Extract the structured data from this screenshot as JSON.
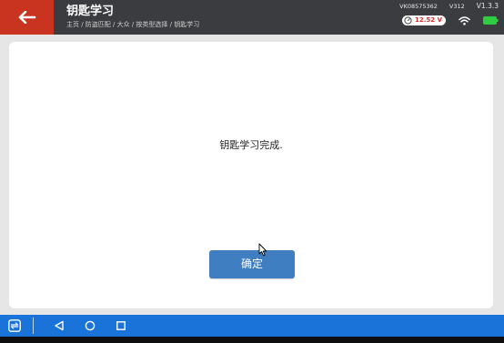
{
  "header": {
    "title": "钥匙学习",
    "breadcrumb": "主页 / 防盗匹配 / 大众 / 按类型选择 / 钥匙学习",
    "serial": "VK08575362",
    "version_code": "V312",
    "version": "V1.3.3",
    "voltage": "12.52 V",
    "icons": {
      "back": "back-arrow-icon",
      "voltage": "voltage-gauge-icon",
      "wifi": "wifi-icon",
      "battery": "battery-icon"
    },
    "colors": {
      "back_button": "#c8341f",
      "header_bg": "#3b3c3f",
      "voltage_text": "#d32f2f",
      "battery": "#2ecc40"
    }
  },
  "main": {
    "message": "钥匙学习完成.",
    "confirm_label": "确定"
  },
  "navbar": {
    "icons": [
      "app-switch-icon",
      "back-triangle-icon",
      "home-circle-icon",
      "recent-square-icon"
    ],
    "color": "#1a73d9"
  }
}
